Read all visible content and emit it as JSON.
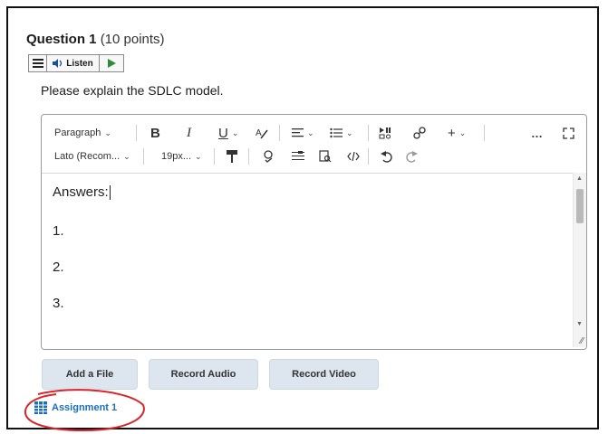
{
  "question": {
    "title": "Question 1",
    "points": "(10 points)",
    "prompt": "Please explain the SDLC model."
  },
  "readspeaker": {
    "listen_label": "Listen",
    "menu_icon": "menu-icon",
    "play_icon": "play-icon",
    "speaker_icon": "speaker-icon"
  },
  "toolbar": {
    "format_block": "Paragraph",
    "bold": "B",
    "italic": "I",
    "underline": "U",
    "more": "…",
    "font_family": "Lato (Recom...",
    "font_size": "19px...",
    "plus": "+"
  },
  "editor": {
    "lines": [
      "Answers:",
      "1.",
      "2.",
      "3."
    ]
  },
  "actions": {
    "add_file": "Add a File",
    "record_audio": "Record Audio",
    "record_video": "Record Video"
  },
  "attachment": {
    "label": "Assignment 1",
    "highlight_color": "#d9262c"
  }
}
